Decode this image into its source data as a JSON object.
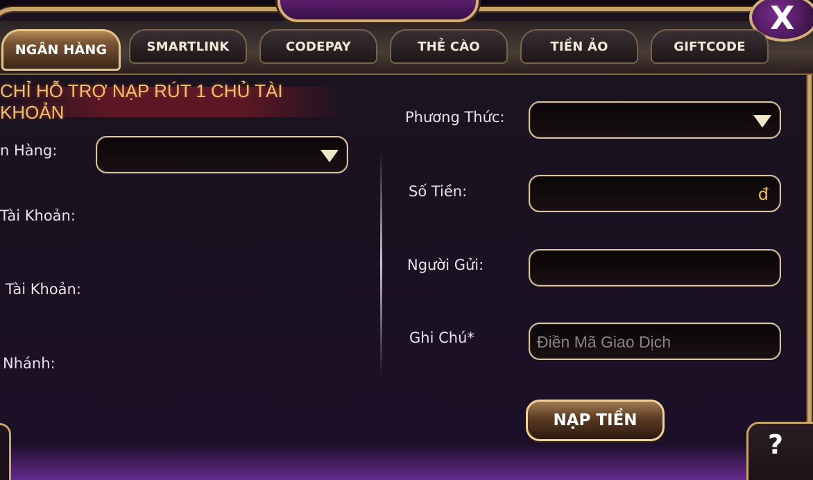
{
  "tabs": [
    {
      "label": "NGÂN HÀNG",
      "active": true
    },
    {
      "label": "SMARTLINK"
    },
    {
      "label": "CODEPAY"
    },
    {
      "label": "THẺ CÀO"
    },
    {
      "label": "TIỀN ẢO"
    },
    {
      "label": "GIFTCODE"
    }
  ],
  "left_panel": {
    "notice": "CHỈ HỖ TRỢ NẠP RÚT 1 CHỦ TÀI KHOẢN",
    "bank_label": "n Hàng:",
    "account_number_label": "Tài Khoản:",
    "account_name_label": "Tài Khoản:",
    "branch_label": "Nhánh:"
  },
  "right_panel": {
    "method_label": "Phương Thức:",
    "amount_label": "Số Tiền:",
    "amount_suffix": "đ",
    "sender_label": "Người Gửi:",
    "note_label": "Ghi Chú*",
    "note_placeholder": "Điền Mã Giao Dịch",
    "submit_label": "NẠP TIỀN"
  },
  "controls": {
    "close_glyph": "X",
    "help_glyph": "?"
  },
  "colors": {
    "accent_gold": "#d4ae78",
    "title_text": "#f0c070",
    "currency": "#f0c060",
    "background": "#1a1220",
    "purple_glow": "#3a1060"
  }
}
